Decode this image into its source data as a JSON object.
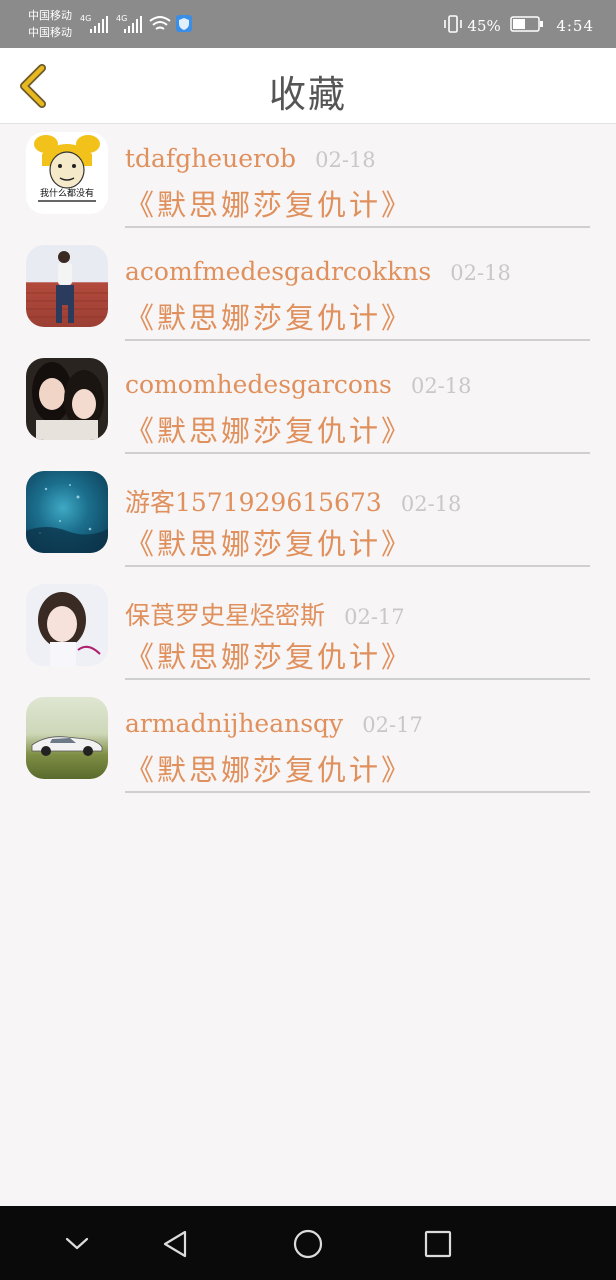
{
  "status_bar": {
    "carrier1": "中国移动",
    "carrier2": "中国移动",
    "network1": "4G",
    "network2": "4G",
    "battery_percent": "45%",
    "time": "4:54"
  },
  "header": {
    "title": "收藏",
    "back_icon": "chevron-left-icon"
  },
  "favorites": [
    {
      "username": "tdafgheuerob",
      "date": "02-18",
      "book": "《默思娜莎复仇计》",
      "avatar_text": "我什么都没有"
    },
    {
      "username": "acomfmedesgadrcokkns",
      "date": "02-18",
      "book": "《默思娜莎复仇计》"
    },
    {
      "username": "comomhedesgarcons",
      "date": "02-18",
      "book": "《默思娜莎复仇计》"
    },
    {
      "username": "游客1571929615673",
      "date": "02-18",
      "book": "《默思娜莎复仇计》"
    },
    {
      "username": "保莨罗史星烃密斯",
      "date": "02-17",
      "book": "《默思娜莎复仇计》"
    },
    {
      "username": "armadnijheansqy",
      "date": "02-17",
      "book": "《默思娜莎复仇计》"
    }
  ],
  "colors": {
    "accent": "#e0905c",
    "date": "#c8c8c8",
    "status_bar": "#8b8b8b",
    "nav_bar": "#0a0a0a",
    "back_icon": "#e8b820"
  },
  "nav_bar": {
    "icons": [
      "chevron-down-icon",
      "back-triangle-icon",
      "home-circle-icon",
      "recents-square-icon"
    ]
  }
}
